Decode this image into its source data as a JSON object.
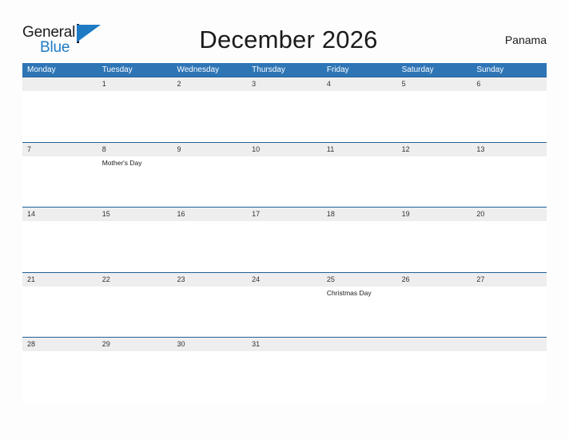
{
  "brand": {
    "name_top": "General",
    "name_bottom": "Blue",
    "flag_icon": "blue-triangle-flag-icon",
    "color_black": "#1b1b1b",
    "color_blue": "#1f7ac4"
  },
  "header": {
    "title": "December 2026",
    "location": "Panama"
  },
  "theme": {
    "header_band": "#2e75b6",
    "row_rule": "#1f6099",
    "date_band": "#eeeeee",
    "cell_bg": "#ffffff",
    "page_bg": "#fdfdfd"
  },
  "calendar": {
    "weekdays": [
      "Monday",
      "Tuesday",
      "Wednesday",
      "Thursday",
      "Friday",
      "Saturday",
      "Sunday"
    ],
    "weeks": [
      {
        "days": [
          {
            "num": "",
            "events": []
          },
          {
            "num": "1",
            "events": []
          },
          {
            "num": "2",
            "events": []
          },
          {
            "num": "3",
            "events": []
          },
          {
            "num": "4",
            "events": []
          },
          {
            "num": "5",
            "events": []
          },
          {
            "num": "6",
            "events": []
          }
        ]
      },
      {
        "days": [
          {
            "num": "7",
            "events": []
          },
          {
            "num": "8",
            "events": [
              "Mother's Day"
            ]
          },
          {
            "num": "9",
            "events": []
          },
          {
            "num": "10",
            "events": []
          },
          {
            "num": "11",
            "events": []
          },
          {
            "num": "12",
            "events": []
          },
          {
            "num": "13",
            "events": []
          }
        ]
      },
      {
        "days": [
          {
            "num": "14",
            "events": []
          },
          {
            "num": "15",
            "events": []
          },
          {
            "num": "16",
            "events": []
          },
          {
            "num": "17",
            "events": []
          },
          {
            "num": "18",
            "events": []
          },
          {
            "num": "19",
            "events": []
          },
          {
            "num": "20",
            "events": []
          }
        ]
      },
      {
        "days": [
          {
            "num": "21",
            "events": []
          },
          {
            "num": "22",
            "events": []
          },
          {
            "num": "23",
            "events": []
          },
          {
            "num": "24",
            "events": []
          },
          {
            "num": "25",
            "events": [
              "Christmas Day"
            ]
          },
          {
            "num": "26",
            "events": []
          },
          {
            "num": "27",
            "events": []
          }
        ]
      },
      {
        "days": [
          {
            "num": "28",
            "events": []
          },
          {
            "num": "29",
            "events": []
          },
          {
            "num": "30",
            "events": []
          },
          {
            "num": "31",
            "events": []
          },
          {
            "num": "",
            "events": []
          },
          {
            "num": "",
            "events": []
          },
          {
            "num": "",
            "events": []
          }
        ]
      }
    ]
  }
}
